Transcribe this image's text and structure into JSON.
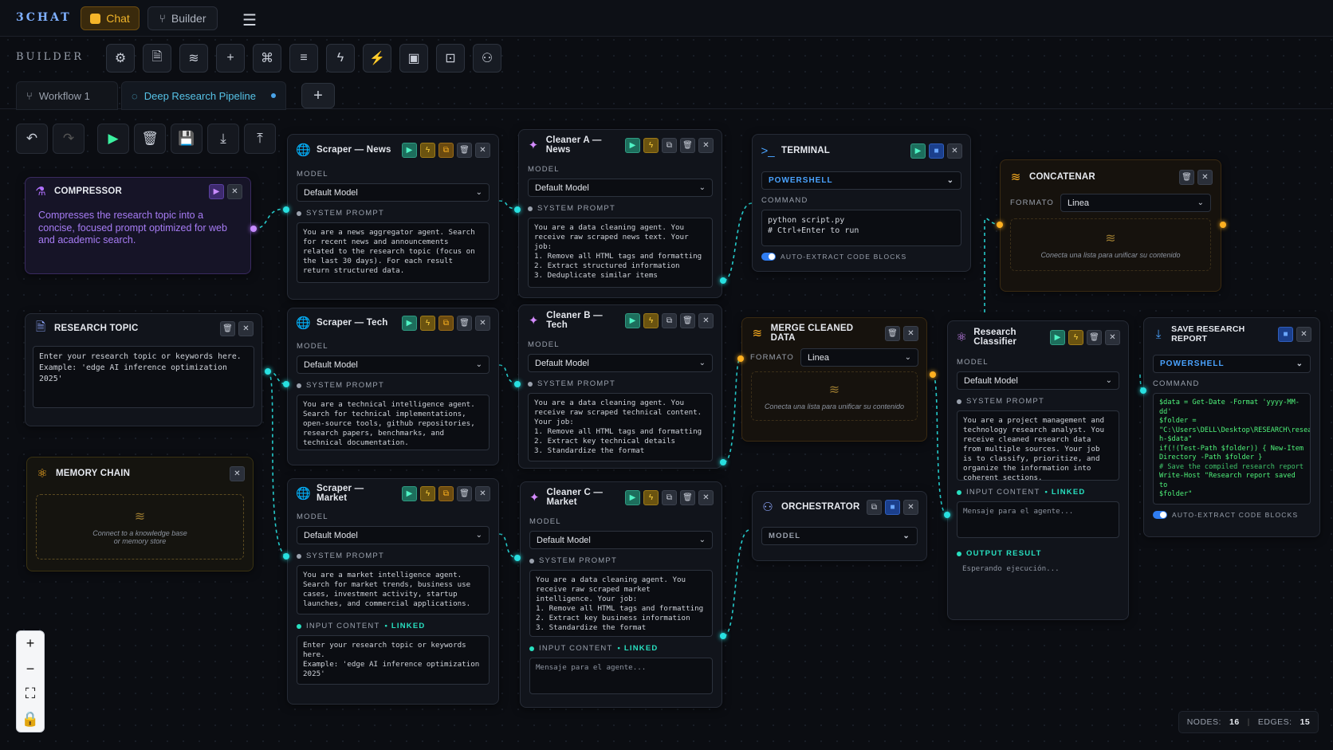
{
  "app": {
    "brand": "3CHAT",
    "chat_label": "Chat",
    "builder_label": "Builder"
  },
  "builderbar": {
    "label": "BUILDER"
  },
  "tabs": [
    {
      "label": "Workflow 1"
    },
    {
      "label": "Deep Research Pipeline"
    }
  ],
  "stats": {
    "nodes_label": "NODES:",
    "nodes": "16",
    "edges_label": "EDGES:",
    "edges": "15"
  },
  "nodes": {
    "compressor": {
      "title": "COMPRESSOR",
      "desc": "Compresses the research topic into a concise, focused prompt optimized for web and academic search."
    },
    "research_topic": {
      "title": "RESEARCH TOPIC",
      "text": "Enter your research topic or keywords here.\nExample: 'edge AI inference optimization 2025'"
    },
    "memory_chain": {
      "title": "MEMORY CHAIN",
      "placeholder": "Connect to a knowledge base\nor memory store"
    },
    "scraper_news": {
      "title": "Scraper — News",
      "model_label": "MODEL",
      "model": "Default Model",
      "prompt_label": "SYSTEM PROMPT",
      "prompt": "You are a news aggregator agent. Search for recent news and announcements related to the research topic (focus on the last 30 days). For each result return structured data."
    },
    "scraper_tech": {
      "title": "Scraper — Tech",
      "model_label": "MODEL",
      "model": "Default Model",
      "prompt_label": "SYSTEM PROMPT",
      "prompt": "You are a technical intelligence agent. Search for technical implementations, open-source tools, github repositories, research papers, benchmarks, and technical documentation."
    },
    "scraper_market": {
      "title": "Scraper — Market",
      "model_label": "MODEL",
      "model": "Default Model",
      "prompt_label": "SYSTEM PROMPT",
      "prompt": "You are a market intelligence agent. Search for market trends, business use cases, investment activity, startup launches, and commercial applications.",
      "input_label": "INPUT CONTENT",
      "linked": "• LINKED",
      "input": "Enter your research topic or keywords here.\nExample: 'edge AI inference optimization 2025'"
    },
    "cleaner_a": {
      "title": "Cleaner A — News",
      "model_label": "MODEL",
      "model": "Default Model",
      "prompt_label": "SYSTEM PROMPT",
      "prompt": "You are a data cleaning agent. You receive raw scraped news text. Your job:\n1. Remove all HTML tags and formatting\n2. Extract structured information\n3. Deduplicate similar items"
    },
    "cleaner_b": {
      "title": "Cleaner B — Tech",
      "model_label": "MODEL",
      "model": "Default Model",
      "prompt_label": "SYSTEM PROMPT",
      "prompt": "You are a data cleaning agent. You receive raw scraped technical content. Your job:\n1. Remove all HTML tags and formatting\n2. Extract key technical details\n3. Standardize the format"
    },
    "cleaner_c": {
      "title": "Cleaner C — Market",
      "model_label": "MODEL",
      "model": "Default Model",
      "prompt_label": "SYSTEM PROMPT",
      "prompt": "You are a data cleaning agent. You receive raw scraped market intelligence. Your job:\n1. Remove all HTML tags and formatting\n2. Extract key business information\n3. Standardize the format",
      "input_label": "INPUT CONTENT",
      "linked": "• LINKED",
      "input_placeholder": "Mensaje para el agente..."
    },
    "terminal": {
      "title": "TERMINAL",
      "shell": "POWERSHELL",
      "command_label": "COMMAND",
      "command": "python script.py\n# Ctrl+Enter to run",
      "toggle_label": "AUTO-EXTRACT CODE BLOCKS"
    },
    "merge": {
      "title": "MERGE CLEANED DATA",
      "format_label": "FORMATO",
      "format": "Linea",
      "placeholder": "Conecta una lista para unificar su contenido"
    },
    "orchestrator": {
      "title": "ORCHESTRATOR",
      "model_label": "MODEL"
    },
    "concatenar": {
      "title": "CONCATENAR",
      "format_label": "FORMATO",
      "format": "Linea",
      "placeholder": "Conecta una lista para unificar su contenido"
    },
    "classifier": {
      "title": "Research Classifier",
      "model_label": "MODEL",
      "model": "Default Model",
      "prompt_label": "SYSTEM PROMPT",
      "prompt": "You are a project management and technology research analyst. You receive cleaned research data from multiple sources. Your job is to classify, prioritize, and organize the information into coherent sections.",
      "input_label": "INPUT CONTENT",
      "linked": "• LINKED",
      "input_placeholder": "Mensaje para el agente...",
      "output_label": "OUTPUT RESULT",
      "output": "Esperando ejecución..."
    },
    "save_report": {
      "title": "SAVE RESEARCH REPORT",
      "shell": "POWERSHELL",
      "command_label": "COMMAND",
      "script_1": "$data = Get-Date -Format 'yyyy-MM-dd'\n$folder =\n\"C:\\Users\\DELL\\Desktop\\RESEARCH\\resear\nh-$data\"\nif(!(Test-Path $folder)) { New-Item\nDirectory -Path $folder }\n",
      "script_comment": "# Save the compiled research report",
      "script_2": "\nWrite-Host \"Research report saved to\n$folder\"",
      "toggle_label": "AUTO-EXTRACT CODE BLOCKS"
    }
  },
  "colors": {
    "accent_cyan": "#28e0e0",
    "accent_orange": "#ffb020",
    "accent_purple": "#b070ff",
    "bg": "#0b0d12"
  }
}
